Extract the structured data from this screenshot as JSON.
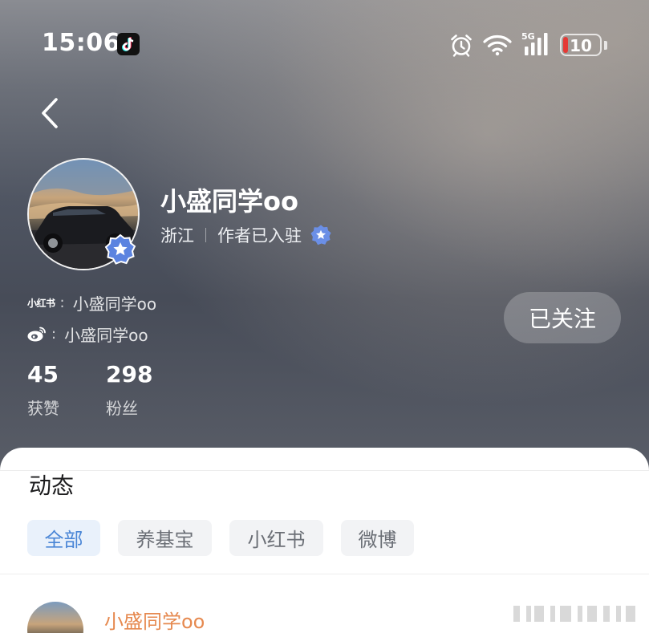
{
  "status_bar": {
    "time": "15:06",
    "app_icon": "tiktok-icon",
    "network": "5G",
    "battery_level": "10",
    "battery_color": "#e53935",
    "icons": [
      "alarm-icon",
      "wifi-icon",
      "signal-icon",
      "battery-icon"
    ]
  },
  "nav": {
    "back_icon": "chevron-left-icon"
  },
  "profile": {
    "name": "小盛同学oo",
    "location": "浙江",
    "author_status": "作者已入驻",
    "verified_badge_color": "#5b83e0",
    "social": [
      {
        "platform_mark": "小红书",
        "colon": ":",
        "handle": "小盛同学oo"
      },
      {
        "platform_mark": "weibo-icon",
        "colon": ":",
        "handle": "小盛同学oo"
      }
    ],
    "follow_button_label": "已关注",
    "stats": [
      {
        "value": "45",
        "label": "获赞"
      },
      {
        "value": "298",
        "label": "粉丝"
      }
    ]
  },
  "feed": {
    "section_title": "动态",
    "tabs": [
      {
        "label": "全部",
        "active": true
      },
      {
        "label": "养基宝",
        "active": false
      },
      {
        "label": "小红书",
        "active": false
      },
      {
        "label": "微博",
        "active": false
      }
    ],
    "first_item_author": "小盛同学oo",
    "accent_color": "#e6894f"
  }
}
